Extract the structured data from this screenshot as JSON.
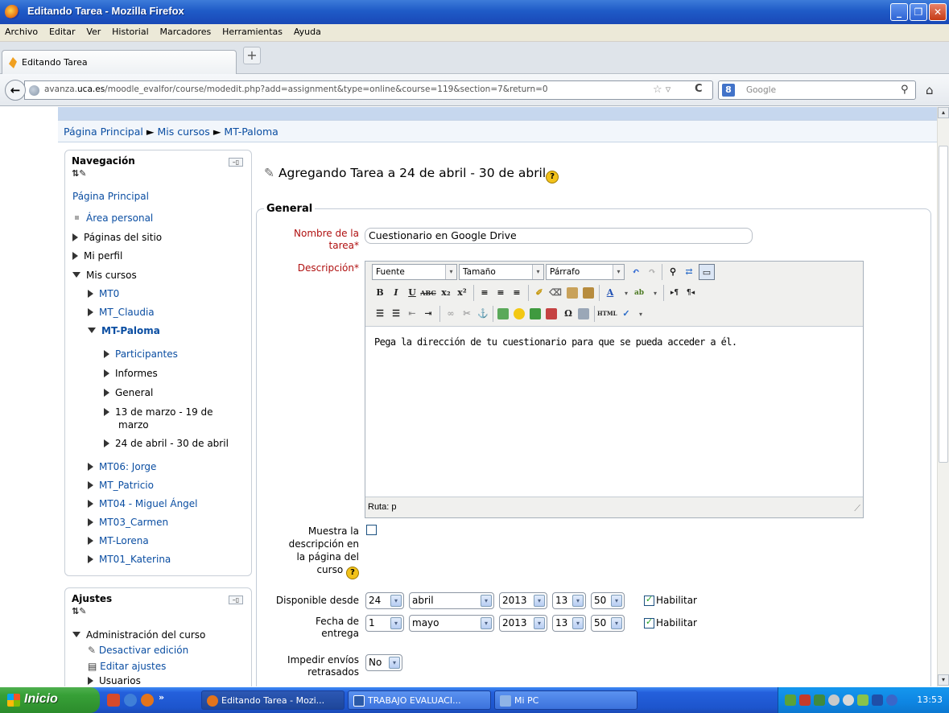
{
  "window": {
    "title": "Editando Tarea - Mozilla Firefox"
  },
  "menu": [
    "Archivo",
    "Editar",
    "Ver",
    "Historial",
    "Marcadores",
    "Herramientas",
    "Ayuda"
  ],
  "tab": {
    "label": "Editando Tarea",
    "new_tab": "+"
  },
  "nav": {
    "url_domain_prefix": "avanza.",
    "url_domain": "uca.es",
    "url_path": "/moodle_evalfor/course/modedit.php?add=assignment&type=online&course=119&section=7&return=0",
    "search_placeholder": "Google"
  },
  "breadcrumb": {
    "home": "Página Principal",
    "sep": "►",
    "my_courses": "Mis cursos",
    "course": "MT-Paloma"
  },
  "navblock": {
    "title": "Navegación",
    "home": "Página Principal",
    "items": [
      {
        "label": "Área personal"
      },
      {
        "label": "Páginas del sitio"
      },
      {
        "label": "Mi perfil"
      },
      {
        "label": "Mis cursos"
      },
      {
        "label": "MT0"
      },
      {
        "label": "MT_Claudia"
      },
      {
        "label": "MT-Paloma"
      },
      {
        "label": "Participantes"
      },
      {
        "label": "Informes"
      },
      {
        "label": "General"
      },
      {
        "label": "13 de marzo - 19 de"
      },
      {
        "label": "marzo"
      },
      {
        "label": "24 de abril - 30 de abril"
      },
      {
        "label": "MT06: Jorge"
      },
      {
        "label": "MT_Patricio"
      },
      {
        "label": "MT04 - Miguel Ángel"
      },
      {
        "label": "MT03_Carmen"
      },
      {
        "label": "MT-Lorena"
      },
      {
        "label": "MT01_Katerina"
      }
    ]
  },
  "settingsblock": {
    "title": "Ajustes",
    "items": [
      "Administración del curso",
      "Desactivar edición",
      "Editar ajustes",
      "Usuarios"
    ]
  },
  "form": {
    "heading": "Agregando Tarea a 24 de abril - 30 de abril",
    "legend": "General",
    "nombre_label_1": "Nombre de la",
    "nombre_label_2": "tarea",
    "nombre_value": "Cuestionario en Google Drive",
    "descripcion_label": "Descripción",
    "editor": {
      "font": "Fuente",
      "size": "Tamaño",
      "format": "Párrafo",
      "content": "Pega la dirección de tu cuestionario para que se pueda acceder a él.",
      "path": "Ruta: p"
    },
    "show_desc_label": [
      "Muestra la",
      "descripción en",
      "la página del",
      "curso"
    ],
    "available_label": "Disponible desde",
    "available": {
      "day": "24",
      "month": "abril",
      "year": "2013",
      "hour": "13",
      "minute": "50",
      "enable": "Habilitar"
    },
    "due_label_1": "Fecha de",
    "due_label_2": "entrega",
    "due": {
      "day": "1",
      "month": "mayo",
      "year": "2013",
      "hour": "13",
      "minute": "50",
      "enable": "Habilitar"
    },
    "prevent_label_1": "Impedir envíos",
    "prevent_label_2": "retrasados",
    "prevent_value": "No"
  },
  "taskbar": {
    "start": "Inicio",
    "tasks": [
      "Editando Tarea - Mozi...",
      "TRABAJO EVALUACI...",
      "Mi PC"
    ],
    "clock": "13:53"
  }
}
